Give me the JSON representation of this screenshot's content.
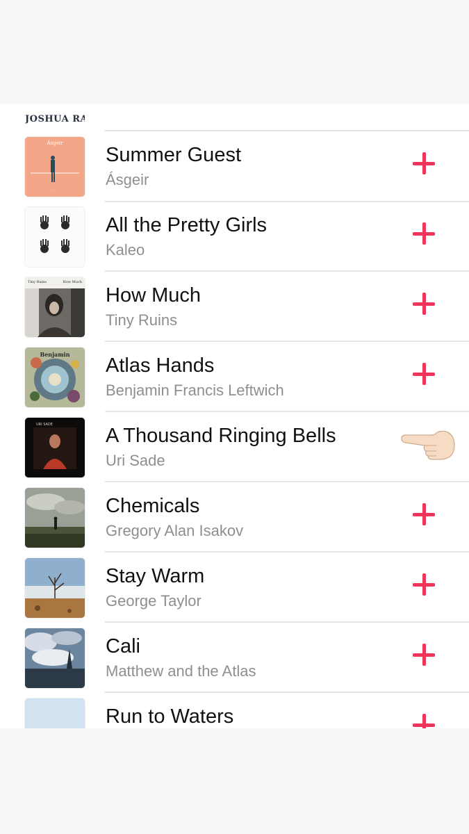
{
  "previous_item": {
    "artwork_text": "JOSHUA RADIN"
  },
  "songs": [
    {
      "title": "Summer Guest",
      "artist": "Ásgeir",
      "action": "add-icon"
    },
    {
      "title": "All the Pretty Girls",
      "artist": "Kaleo",
      "action": "add-icon"
    },
    {
      "title": "How Much",
      "artist": "Tiny Ruins",
      "action": "add-icon"
    },
    {
      "title": "Atlas Hands",
      "artist": "Benjamin Francis Leftwich",
      "action": "add-icon"
    },
    {
      "title": "A Thousand Ringing Bells",
      "artist": "Uri Sade",
      "action": "pointing-hand-icon"
    },
    {
      "title": "Chemicals",
      "artist": "Gregory Alan Isakov",
      "action": "add-icon"
    },
    {
      "title": "Stay Warm",
      "artist": "George Taylor",
      "action": "add-icon"
    },
    {
      "title": "Cali",
      "artist": "Matthew and the Atlas",
      "action": "add-icon"
    },
    {
      "title": "Run to Waters",
      "artist": "",
      "action": "add-icon"
    }
  ],
  "album_art_text": {
    "asgeir": "Ásgeir",
    "tiny_ruins_left": "Tiny\nRuins",
    "tiny_ruins_right": "How\nMuch",
    "benjamin": "Benjamin",
    "uri_sade": "URI SADE"
  },
  "colors": {
    "accent": "#f0355b",
    "title_text": "#111111",
    "artist_text": "#8e8e93",
    "divider": "#e4e4e7"
  }
}
